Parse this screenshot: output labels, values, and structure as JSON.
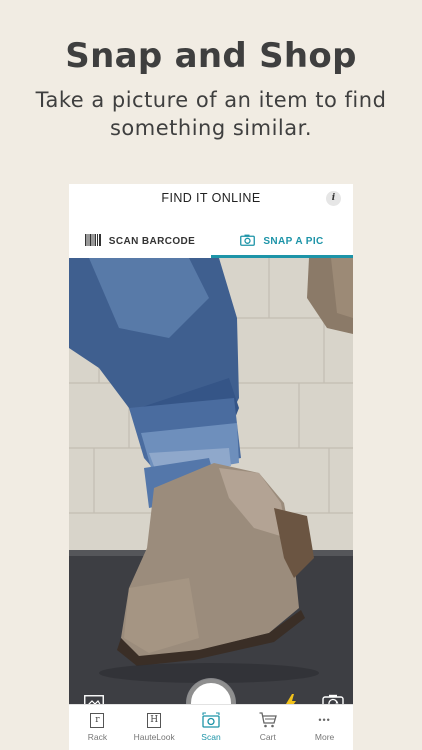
{
  "promo": {
    "headline": "Snap and Shop",
    "subline": "Take a picture of an item to find something similar."
  },
  "header": {
    "title": "FIND IT ONLINE",
    "info_glyph": "i"
  },
  "tabs": [
    {
      "label": "SCAN BARCODE",
      "icon": "barcode-icon",
      "active": false
    },
    {
      "label": "SNAP A PIC",
      "icon": "camera-icon",
      "active": true
    }
  ],
  "camera": {
    "controls": [
      "gallery-icon",
      "shutter-button",
      "flash-icon",
      "flip-camera-icon"
    ]
  },
  "bottom_nav": [
    {
      "label": "Rack",
      "icon": "rack-icon",
      "glyph": "r",
      "active": false
    },
    {
      "label": "HauteLook",
      "icon": "hautelook-icon",
      "glyph": "H",
      "active": false
    },
    {
      "label": "Scan",
      "icon": "scan-icon",
      "active": true
    },
    {
      "label": "Cart",
      "icon": "cart-icon",
      "active": false
    },
    {
      "label": "More",
      "icon": "more-icon",
      "glyph": "•••",
      "active": false
    }
  ],
  "colors": {
    "background": "#f1ece3",
    "accent": "#1d94a8",
    "flash": "#f2c21b"
  }
}
